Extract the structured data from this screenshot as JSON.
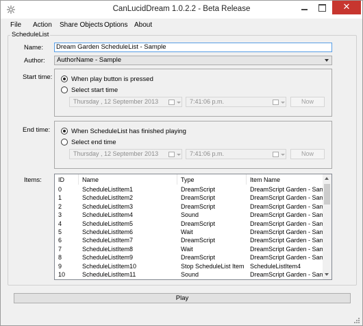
{
  "window": {
    "title": "CanLucidDream 1.0.2.2 - Beta Release",
    "close_glyph": "✕"
  },
  "menu": [
    {
      "label": "File"
    },
    {
      "label": "Action"
    },
    {
      "label": "Share Objects"
    },
    {
      "label": "Options"
    },
    {
      "label": "About"
    }
  ],
  "group": {
    "label": "ScheduleList"
  },
  "form": {
    "name_label": "Name:",
    "name_value": "Dream Garden ScheduleList - Sample",
    "author_label": "Author:",
    "author_value": "AuthorName - Sample",
    "start_label": "Start time:",
    "end_label": "End time:",
    "items_label": "Items:"
  },
  "start": {
    "option1": "When play button is pressed",
    "option2": "Select start time",
    "date": "Thursday   , 12 September 2013",
    "time": "7:41:06 p.m.",
    "now_label": "Now"
  },
  "end": {
    "option1": "When ScheduleList has finished playing",
    "option2": "Select end time",
    "date": "Thursday   , 12 September 2013",
    "time": "7:41:06 p.m.",
    "now_label": "Now"
  },
  "items": {
    "columns": [
      "ID",
      "Name",
      "Type",
      "Item Name"
    ],
    "rows": [
      {
        "id": "0",
        "name": "ScheduleListItem1",
        "type": "DreamScript",
        "item": "DreamScript Garden - Sam..."
      },
      {
        "id": "1",
        "name": "ScheduleListItem2",
        "type": "DreamScript",
        "item": "DreamScript Garden - Sam..."
      },
      {
        "id": "2",
        "name": "ScheduleListItem3",
        "type": "DreamScript",
        "item": "DreamScript Garden - Sam..."
      },
      {
        "id": "3",
        "name": "ScheduleListItem4",
        "type": "Sound",
        "item": "DreamScript Garden - Sam..."
      },
      {
        "id": "4",
        "name": "ScheduleListItem5",
        "type": "DreamScript",
        "item": "DreamScript Garden - Sam..."
      },
      {
        "id": "5",
        "name": "ScheduleListItem6",
        "type": "Wait",
        "item": "DreamScript Garden - Sam..."
      },
      {
        "id": "6",
        "name": "ScheduleListItem7",
        "type": "DreamScript",
        "item": "DreamScript Garden - Sam..."
      },
      {
        "id": "7",
        "name": "ScheduleListItem8",
        "type": "Wait",
        "item": "DreamScript Garden - Sam..."
      },
      {
        "id": "8",
        "name": "ScheduleListItem9",
        "type": "DreamScript",
        "item": "DreamScript Garden - Sam..."
      },
      {
        "id": "9",
        "name": "ScheduleListItem10",
        "type": "Stop ScheduleList Item",
        "item": "ScheduleListItem4"
      },
      {
        "id": "10",
        "name": "ScheduleListItem11",
        "type": "Sound",
        "item": "DreamScript Garden - Sam..."
      }
    ]
  },
  "play_label": "Play",
  "icons": [
    "app-icon",
    "minimize-icon",
    "maximize-icon",
    "close-icon",
    "calendar-icon",
    "chevron-down-icon",
    "scroll-up-icon",
    "scroll-down-icon",
    "resize-grip-icon"
  ],
  "colors": {
    "close_button": "#c7362f",
    "focus_border": "#569de5"
  }
}
